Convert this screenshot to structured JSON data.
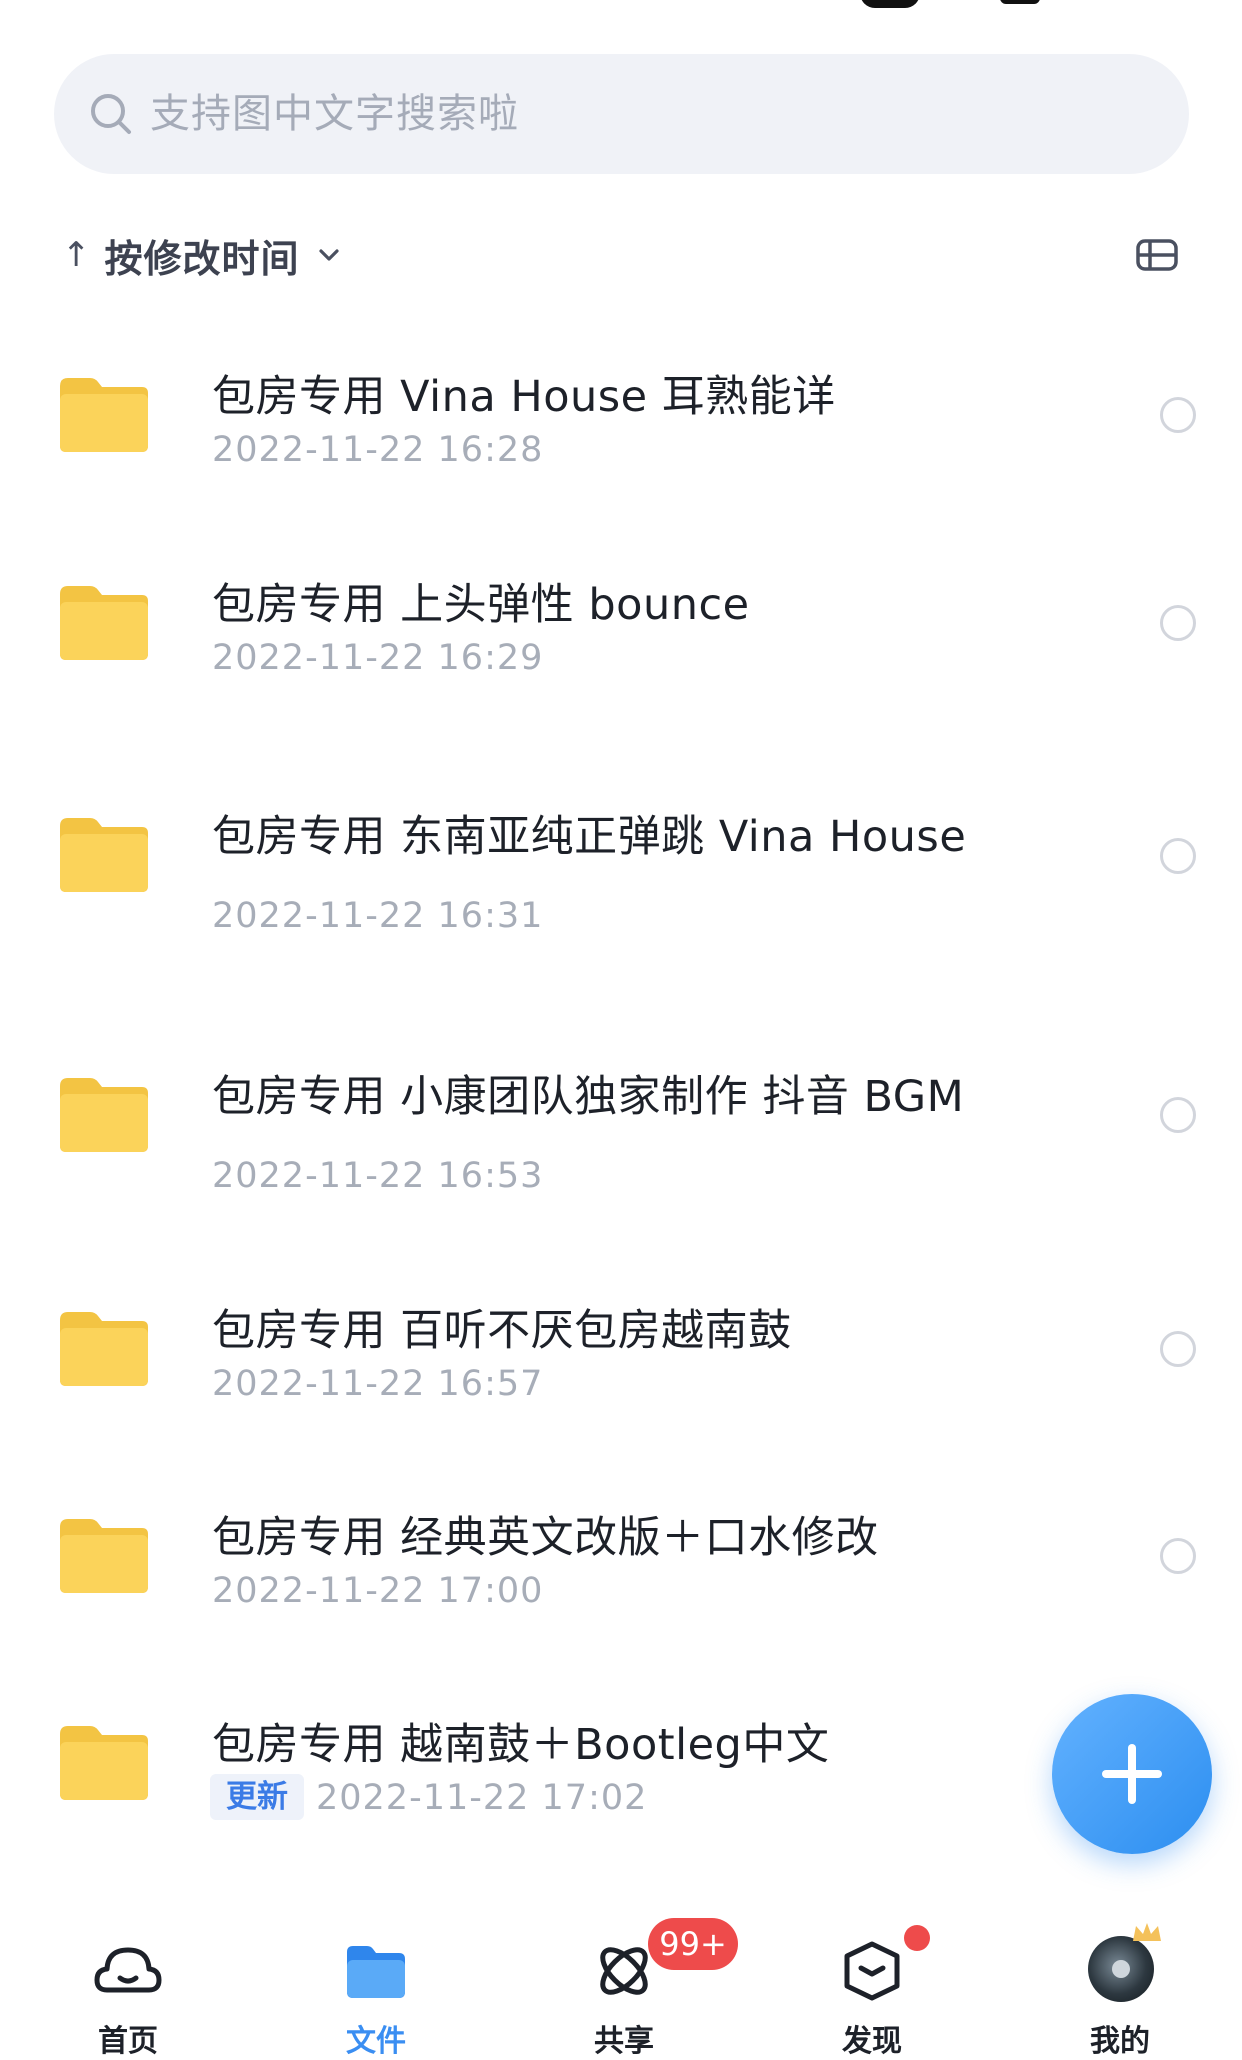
{
  "search": {
    "placeholder": "支持图中文字搜索啦"
  },
  "sort": {
    "arrow": "↑",
    "label": "按修改时间"
  },
  "files": [
    {
      "name": "包房专用  Vina House 耳熟能详",
      "date": "2022-11-22 16:28"
    },
    {
      "name": "包房专用  上头弹性 bounce",
      "date": "2022-11-22 16:29"
    },
    {
      "name": "包房专用  东南亚纯正弹跳 Vina House",
      "date": "2022-11-22 16:31"
    },
    {
      "name": "包房专用  小康团队独家制作 抖音 BGM",
      "date": "2022-11-22 16:53"
    },
    {
      "name": "包房专用  百听不厌包房越南鼓",
      "date": "2022-11-22 16:57"
    },
    {
      "name": "包房专用  经典英文改版＋口水修改",
      "date": "2022-11-22 17:00"
    },
    {
      "name": "包房专用  越南鼓＋Bootleg中文",
      "date": "2022-11-22 17:02",
      "badge": "更新"
    }
  ],
  "tabs": [
    {
      "label": "首页",
      "icon": "cloud-icon"
    },
    {
      "label": "文件",
      "icon": "folder-icon",
      "active": true
    },
    {
      "label": "共享",
      "icon": "share-icon",
      "badge": "99+"
    },
    {
      "label": "发现",
      "icon": "discover-icon",
      "dot": true
    },
    {
      "label": "我的",
      "icon": "avatar"
    }
  ],
  "colors": {
    "accent": "#3a8ef2",
    "badge": "#ee4b4b",
    "folder": "#fbd35a"
  }
}
